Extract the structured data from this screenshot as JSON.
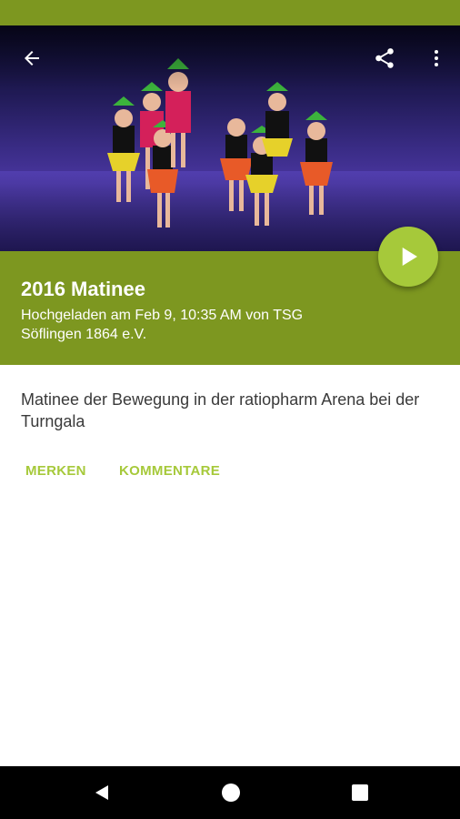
{
  "video": {
    "title": "2016 Matinee",
    "meta": "Hochgeladen am Feb 9, 10:35 AM von TSG Söflingen 1864 e.V.",
    "description": "Matinee der Bewegung in der ratiopharm Arena bei der Turngala"
  },
  "actions": {
    "save_label": "MERKEN",
    "comments_label": "KOMMENTARE"
  },
  "icons": {
    "back": "arrow-back-icon",
    "share": "share-icon",
    "more": "more-vert-icon",
    "play": "play-icon",
    "nav_back": "nav-back-icon",
    "nav_home": "nav-home-icon",
    "nav_recent": "nav-recent-icon"
  },
  "colors": {
    "primary": "#7d9720",
    "accent": "#a6c93a",
    "nav_bar": "#000000"
  }
}
